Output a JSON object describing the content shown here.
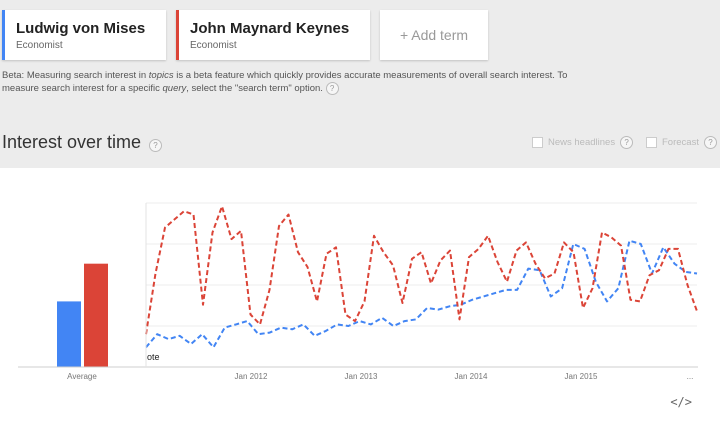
{
  "terms": [
    {
      "name": "Ludwig von Mises",
      "type": "Economist",
      "color": "#4285f4"
    },
    {
      "name": "John Maynard Keynes",
      "type": "Economist",
      "color": "#db4437"
    }
  ],
  "add_term_label": "+ Add term",
  "beta": {
    "prefix": "Beta: Measuring search interest in ",
    "topics": "topics",
    "middle": " is a beta feature which quickly provides accurate measurements of overall search interest. To measure search interest for a specific ",
    "query": "query",
    "suffix": ", select the \"search term\" option."
  },
  "help_glyph": "?",
  "section_title": "Interest over time",
  "options": {
    "news_headlines": "News headlines",
    "forecast": "Forecast"
  },
  "embed_label": "</>",
  "chart_data": {
    "type": "line",
    "average_label": "Average",
    "averages": [
      {
        "name": "Ludwig von Mises",
        "value": 40
      },
      {
        "name": "John Maynard Keynes",
        "value": 63
      }
    ],
    "x_tick_labels": [
      "Jan 2012",
      "Jan 2013",
      "Jan 2014",
      "Jan 2015",
      "..."
    ],
    "note_label": "ote",
    "series": [
      {
        "name": "Ludwig von Mises",
        "color": "#4285f4",
        "values": [
          12,
          20,
          17,
          19,
          14,
          20,
          12,
          24,
          26,
          28,
          20,
          21,
          24,
          23,
          26,
          19,
          22,
          26,
          25,
          28,
          26,
          30,
          25,
          28,
          29,
          36,
          35,
          37,
          38,
          41,
          43,
          45,
          47,
          47,
          60,
          59,
          43,
          48,
          75,
          72,
          52,
          40,
          48,
          77,
          75,
          57,
          73,
          63,
          58,
          57
        ]
      },
      {
        "name": "John Maynard Keynes",
        "color": "#db4437",
        "values": [
          20,
          57,
          85,
          90,
          95,
          93,
          38,
          82,
          98,
          78,
          83,
          32,
          26,
          47,
          86,
          93,
          70,
          61,
          40,
          69,
          73,
          32,
          28,
          40,
          80,
          70,
          62,
          39,
          66,
          70,
          51,
          65,
          71,
          29,
          67,
          72,
          80,
          64,
          52,
          71,
          76,
          63,
          54,
          57,
          76,
          70,
          36,
          48,
          82,
          79,
          74,
          41,
          40,
          56,
          59,
          72,
          72,
          50,
          34
        ]
      }
    ]
  }
}
